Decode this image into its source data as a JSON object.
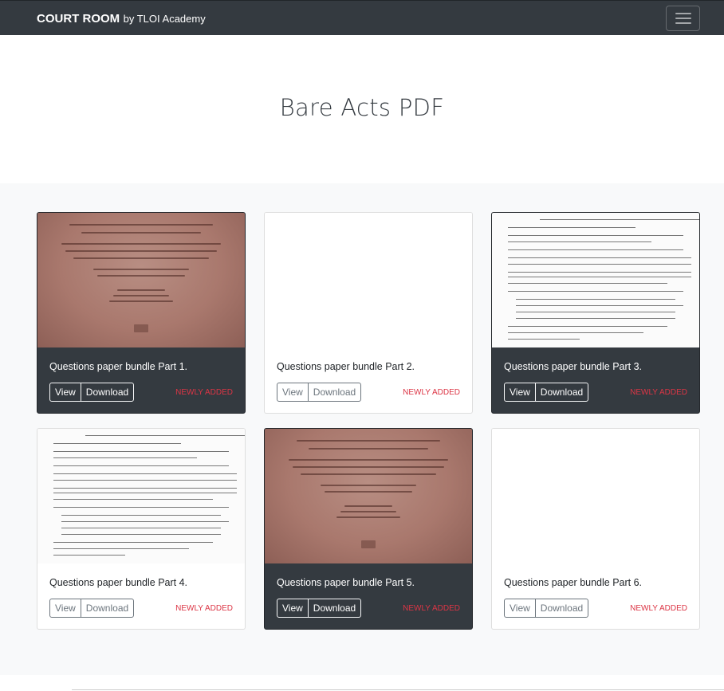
{
  "navbar": {
    "brand_main": "COURT ROOM",
    "brand_sub": "by TLOI Academy",
    "toggler_icon": "hamburger-menu-icon"
  },
  "hero": {
    "title": "Bare Acts PDF"
  },
  "cards": [
    {
      "title": "Questions paper bundle Part 1.",
      "view_label": "View",
      "download_label": "Download",
      "badge": "NEWLY ADDED",
      "theme": "dark",
      "thumbnail": "book-cover"
    },
    {
      "title": "Questions paper bundle Part 2.",
      "view_label": "View",
      "download_label": "Download",
      "badge": "NEWLY ADDED",
      "theme": "light",
      "thumbnail": "blank"
    },
    {
      "title": "Questions paper bundle Part 3.",
      "view_label": "View",
      "download_label": "Download",
      "badge": "NEWLY ADDED",
      "theme": "dark",
      "thumbnail": "form-document"
    },
    {
      "title": "Questions paper bundle Part 4.",
      "view_label": "View",
      "download_label": "Download",
      "badge": "NEWLY ADDED",
      "theme": "light",
      "thumbnail": "form-document"
    },
    {
      "title": "Questions paper bundle Part 5.",
      "view_label": "View",
      "download_label": "Download",
      "badge": "NEWLY ADDED",
      "theme": "dark",
      "thumbnail": "book-cover"
    },
    {
      "title": "Questions paper bundle Part 6.",
      "view_label": "View",
      "download_label": "Download",
      "badge": "NEWLY ADDED",
      "theme": "light",
      "thumbnail": "blank"
    }
  ],
  "colors": {
    "navbar_bg": "#343a40",
    "card_dark_bg": "#343a40",
    "badge_color": "#dc3545",
    "album_bg": "#f8f9fa"
  }
}
